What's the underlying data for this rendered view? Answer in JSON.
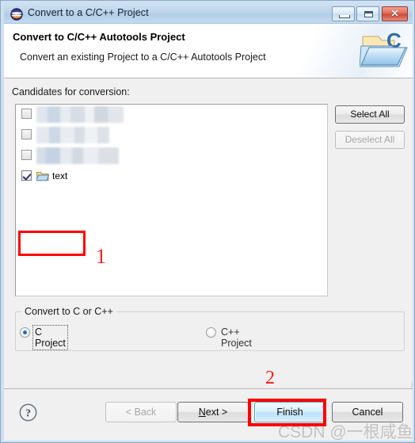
{
  "window": {
    "title": "Convert to a C/C++ Project",
    "app_icon": "eclipse-icon",
    "controls": {
      "minimize": "—",
      "maximize": "□",
      "close": "✕"
    }
  },
  "banner": {
    "title": "Convert to C/C++ Autotools Project",
    "subtitle": "Convert an existing Project to a C/C++ Autotools Project",
    "icon": "folder-c-project-icon"
  },
  "main": {
    "candidates_label": "Candidates for conversion:",
    "list_items": [
      {
        "label": "",
        "checked": false,
        "redacted": true,
        "icon": "folder-icon"
      },
      {
        "label": "",
        "checked": false,
        "redacted": true,
        "icon": "folder-icon"
      },
      {
        "label": "",
        "checked": false,
        "redacted": true,
        "icon": "folder-icon"
      },
      {
        "label": "text",
        "checked": true,
        "redacted": false,
        "icon": "open-folder-icon"
      }
    ],
    "side_buttons": {
      "select_all": "Select All",
      "deselect_all": "Deselect All"
    },
    "group": {
      "legend": "Convert to C or C++",
      "options": [
        {
          "label": "C Project",
          "selected": true
        },
        {
          "label": "C++ Project",
          "selected": false
        }
      ]
    }
  },
  "footer": {
    "help": "?",
    "back": "< Back",
    "next_prefix": "N",
    "next_suffix": "ext >",
    "finish": "Finish",
    "cancel": "Cancel"
  },
  "annotations": {
    "step_one": "1",
    "step_two": "2",
    "highlight_color": "#ff0000"
  },
  "watermark": {
    "text": "CSDN @一根咸鱼"
  }
}
